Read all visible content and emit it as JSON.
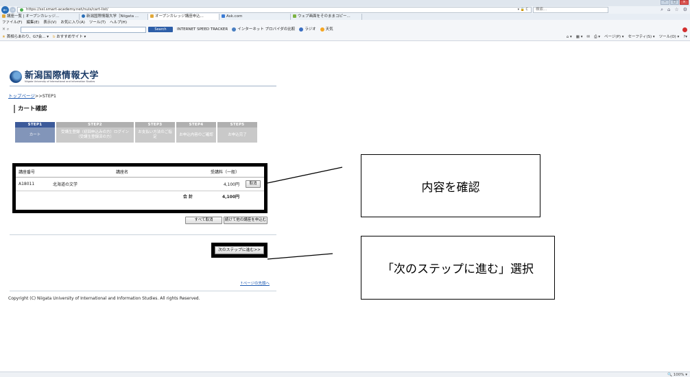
{
  "browser": {
    "url": "https://ssl.smart-academy.net/nuis/cart-list/",
    "url_right": "▾ 🔒 C",
    "search_placeholder": "検索...",
    "tabs": [
      "講座一覧 | オープンカレッジ...",
      "新潟国際情報大学［Niigata ...",
      "オープンカレッジ講座申込...",
      "Ask.com",
      "ウェブ画面をそのままコピー..."
    ],
    "menu": [
      "ファイル(F)",
      "編集(E)",
      "表示(V)",
      "お気に入り(A)",
      "ツール(T)",
      "ヘルプ(H)"
    ],
    "toolbar": {
      "search_button": "Search",
      "links": [
        "INTERNET SPEED TRACKER",
        "インターネット プロバイダの比較",
        "ラジオ",
        "天気"
      ]
    },
    "favorites": {
      "left": [
        "首相らあわり、G7会...",
        "おすすめサイト"
      ],
      "right": [
        "ページ(P)",
        "セーフティ(S)",
        "ツール(O)"
      ]
    },
    "zoom": "100%"
  },
  "site": {
    "logo_jp": "新潟国際情報大学",
    "logo_en": "Niigata University of International and Information Studies",
    "breadcrumb_link": "トップページ",
    "breadcrumb_sep": ">>",
    "breadcrumb_current": "STEP1",
    "page_title": "カート確認",
    "steps": [
      {
        "label": "STEP1",
        "desc": "カート"
      },
      {
        "label": "STEP2",
        "desc": "受講生登録（初回申込みの方）ログイン（受講生登録済の方）"
      },
      {
        "label": "STEP3",
        "desc": "お支払い方法のご指定"
      },
      {
        "label": "STEP4",
        "desc": "お申込内容のご確認"
      },
      {
        "label": "STEP5",
        "desc": "お申込完了"
      }
    ],
    "cart": {
      "headers": [
        "講座番号",
        "講座名",
        "受講料（一般）"
      ],
      "rows": [
        {
          "code": "A18011",
          "name": "北海道の文学",
          "fee": "4,100円",
          "cancel": "取消"
        }
      ],
      "total_label": "合 計",
      "total_value": "4,100円"
    },
    "cancel_all": "すべて取消",
    "continue": "続けて他の講座を申込む",
    "next_step": "次のステップに進む>>",
    "page_top": "↑ページの先頭へ",
    "copyright": "Copyright (C) Niigata University of International and Information Studies. All rights Reserved."
  },
  "annotations": {
    "callout_confirm": "内容を確認",
    "callout_next": "「次のステップに進む」選択"
  }
}
